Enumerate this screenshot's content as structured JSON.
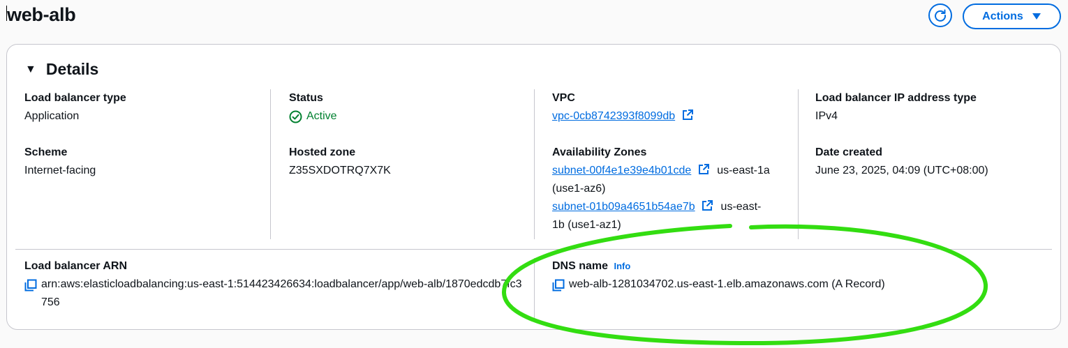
{
  "header": {
    "title": "web-alb",
    "actions_label": "Actions",
    "refresh_icon": "refresh-icon"
  },
  "details": {
    "section_title": "Details",
    "load_balancer_type": {
      "label": "Load balancer type",
      "value": "Application"
    },
    "scheme": {
      "label": "Scheme",
      "value": "Internet-facing"
    },
    "status": {
      "label": "Status",
      "value": "Active",
      "color": "#00802f"
    },
    "hosted_zone": {
      "label": "Hosted zone",
      "value": "Z35SXDOTRQ7X7K"
    },
    "vpc": {
      "label": "VPC",
      "value": "vpc-0cb8742393f8099db"
    },
    "availability_zones": {
      "label": "Availability Zones",
      "items": [
        {
          "subnet": "subnet-00f4e1e39e4b01cde",
          "zone": "us-east-1a (use1-az6)"
        },
        {
          "subnet": "subnet-01b09a4651b54ae7b",
          "zone": "us-east-1b (use1-az1)"
        }
      ]
    },
    "ip_address_type": {
      "label": "Load balancer IP address type",
      "value": "IPv4"
    },
    "date_created": {
      "label": "Date created",
      "value": "June 23, 2025, 04:09 (UTC+08:00)"
    },
    "arn": {
      "label": "Load balancer ARN",
      "value": "arn:aws:elasticloadbalancing:us-east-1:514423426634:loadbalancer/app/web-alb/1870edcdb7fc3756"
    },
    "dns_name": {
      "label": "DNS name",
      "info": "Info",
      "value": "web-alb-1281034702.us-east-1.elb.amazonaws.com (A Record)"
    }
  },
  "colors": {
    "link": "#006ce0",
    "success": "#00802f",
    "annotation": "#33dd11"
  }
}
